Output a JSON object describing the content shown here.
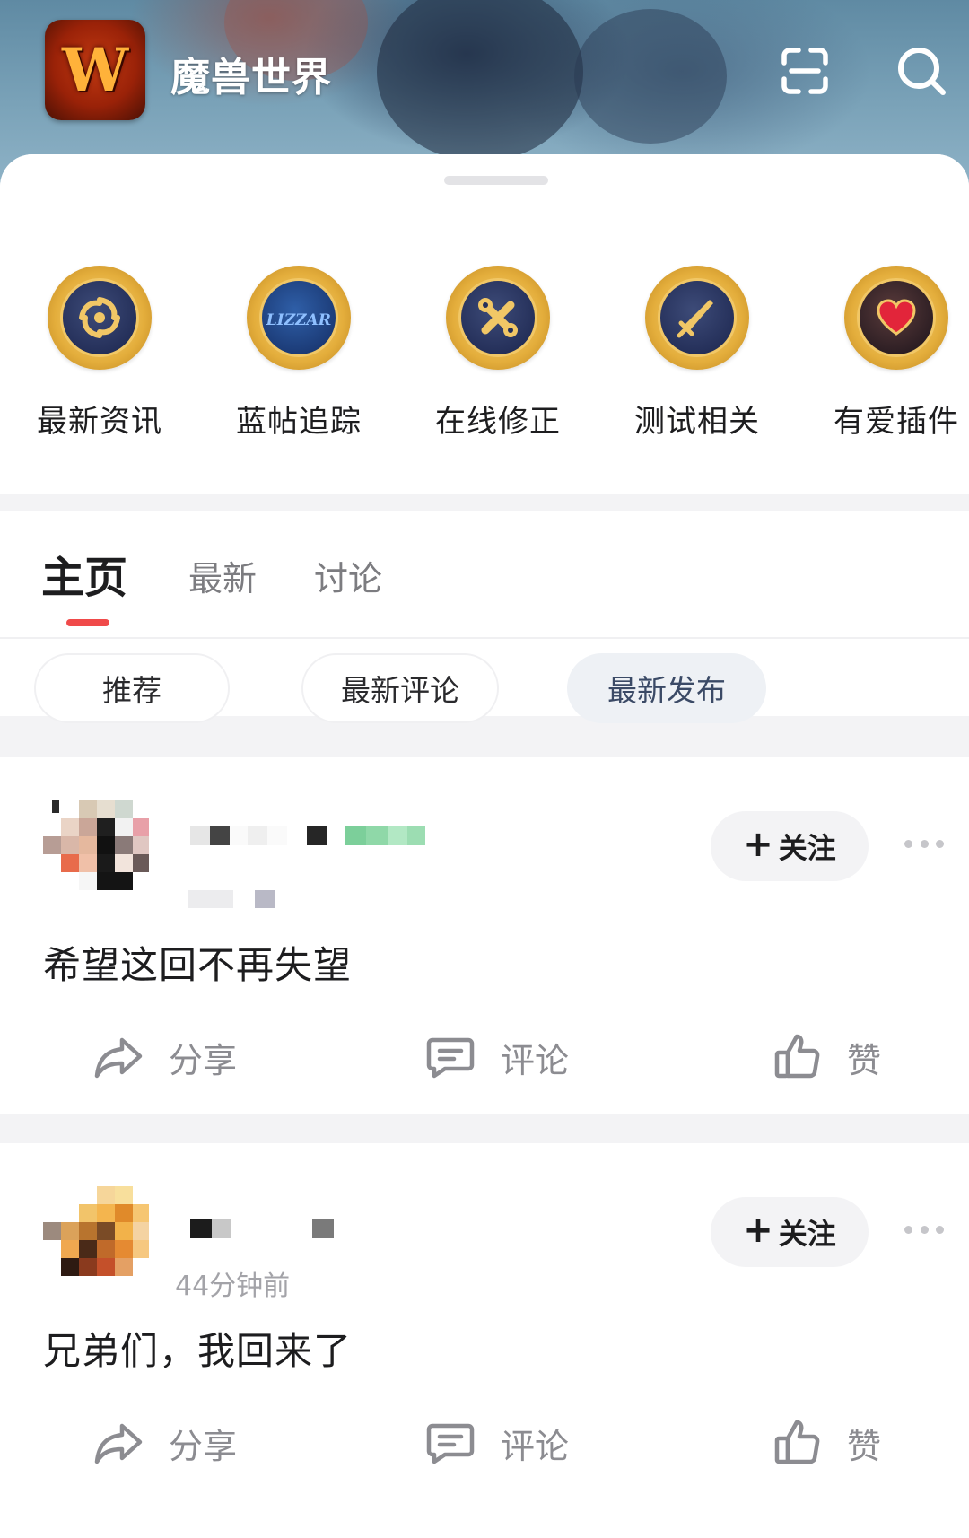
{
  "header": {
    "app_logo_letter": "W",
    "title": "魔兽世界",
    "scan_icon": "scan-icon",
    "search_icon": "search-icon"
  },
  "categories": [
    {
      "label": "最新资讯",
      "icon": "news-badge-icon"
    },
    {
      "label": "蓝帖追踪",
      "icon": "blizzard-badge-icon"
    },
    {
      "label": "在线修正",
      "icon": "wrench-badge-icon"
    },
    {
      "label": "测试相关",
      "icon": "sword-badge-icon"
    },
    {
      "label": "有爱插件",
      "icon": "heart-badge-icon"
    }
  ],
  "tabs": [
    {
      "label": "主页",
      "active": true
    },
    {
      "label": "最新",
      "active": false
    },
    {
      "label": "讨论",
      "active": false
    }
  ],
  "filters": [
    {
      "label": "推荐",
      "active": false
    },
    {
      "label": "最新评论",
      "active": false
    },
    {
      "label": "最新发布",
      "active": true
    }
  ],
  "posts": [
    {
      "meta": "",
      "text": "希望这回不再失望",
      "follow_label": "关注",
      "actions": {
        "share": "分享",
        "comment": "评论",
        "like": "赞"
      }
    },
    {
      "meta": "44分钟前",
      "text": "兄弟们，我回来了",
      "follow_label": "关注",
      "actions": {
        "share": "分享",
        "comment": "评论",
        "like": "赞"
      }
    }
  ],
  "colors": {
    "accent_indicator": "#f04a4a",
    "active_filter_bg": "#eef1f5",
    "badge_gold": "#e4ae3c",
    "badge_navy": "#25305a"
  }
}
